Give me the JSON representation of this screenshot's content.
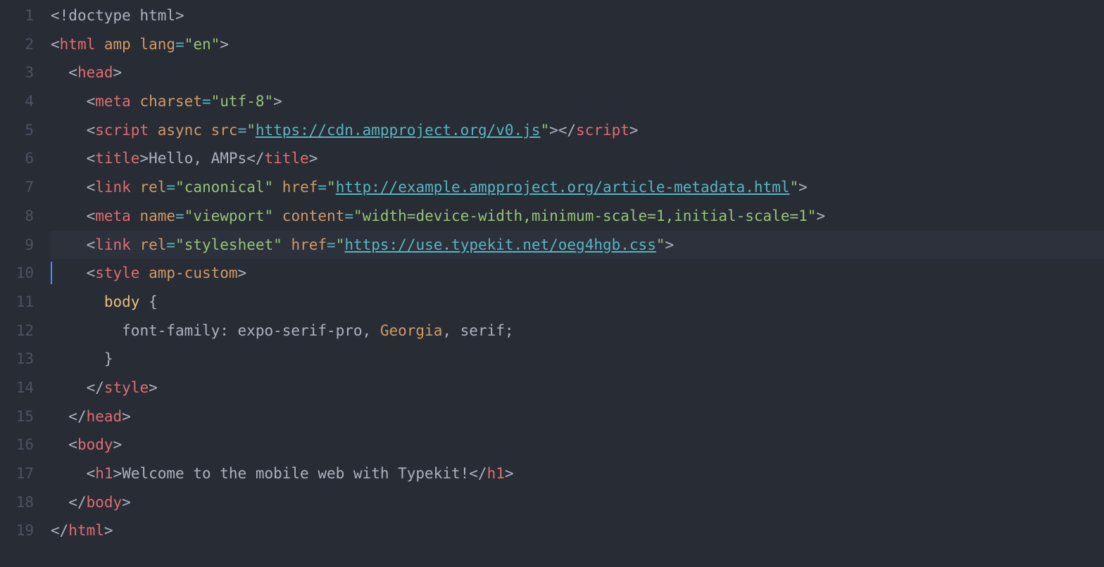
{
  "lines": [
    {
      "num": "1",
      "indent": 0,
      "tokens": [
        {
          "t": "<!",
          "c": "p"
        },
        {
          "t": "doctype html",
          "c": "doctype"
        },
        {
          "t": ">",
          "c": "p"
        }
      ]
    },
    {
      "num": "2",
      "indent": 0,
      "tokens": [
        {
          "t": "<",
          "c": "p"
        },
        {
          "t": "html",
          "c": "tag"
        },
        {
          "t": " ",
          "c": "p"
        },
        {
          "t": "amp",
          "c": "attr"
        },
        {
          "t": " ",
          "c": "p"
        },
        {
          "t": "lang",
          "c": "attr"
        },
        {
          "t": "=",
          "c": "op"
        },
        {
          "t": "\"en\"",
          "c": "str"
        },
        {
          "t": ">",
          "c": "p"
        }
      ]
    },
    {
      "num": "3",
      "indent": 1,
      "tokens": [
        {
          "t": "<",
          "c": "p"
        },
        {
          "t": "head",
          "c": "tag"
        },
        {
          "t": ">",
          "c": "p"
        }
      ]
    },
    {
      "num": "4",
      "indent": 2,
      "tokens": [
        {
          "t": "<",
          "c": "p"
        },
        {
          "t": "meta",
          "c": "tag"
        },
        {
          "t": " ",
          "c": "p"
        },
        {
          "t": "charset",
          "c": "attr"
        },
        {
          "t": "=",
          "c": "op"
        },
        {
          "t": "\"utf-8\"",
          "c": "str"
        },
        {
          "t": ">",
          "c": "p"
        }
      ]
    },
    {
      "num": "5",
      "indent": 2,
      "tokens": [
        {
          "t": "<",
          "c": "p"
        },
        {
          "t": "script",
          "c": "tag"
        },
        {
          "t": " ",
          "c": "p"
        },
        {
          "t": "async",
          "c": "attr"
        },
        {
          "t": " ",
          "c": "p"
        },
        {
          "t": "src",
          "c": "attr"
        },
        {
          "t": "=",
          "c": "op"
        },
        {
          "t": "\"",
          "c": "str"
        },
        {
          "t": "https://cdn.ampproject.org/v0.js",
          "c": "url"
        },
        {
          "t": "\"",
          "c": "str"
        },
        {
          "t": "></",
          "c": "p"
        },
        {
          "t": "script",
          "c": "tag"
        },
        {
          "t": ">",
          "c": "p"
        }
      ]
    },
    {
      "num": "6",
      "indent": 2,
      "tokens": [
        {
          "t": "<",
          "c": "p"
        },
        {
          "t": "title",
          "c": "tag"
        },
        {
          "t": ">",
          "c": "p"
        },
        {
          "t": "Hello, AMPs",
          "c": "text"
        },
        {
          "t": "</",
          "c": "p"
        },
        {
          "t": "title",
          "c": "tag"
        },
        {
          "t": ">",
          "c": "p"
        }
      ]
    },
    {
      "num": "7",
      "indent": 2,
      "tokens": [
        {
          "t": "<",
          "c": "p"
        },
        {
          "t": "link",
          "c": "tag"
        },
        {
          "t": " ",
          "c": "p"
        },
        {
          "t": "rel",
          "c": "attr"
        },
        {
          "t": "=",
          "c": "op"
        },
        {
          "t": "\"canonical\"",
          "c": "str"
        },
        {
          "t": " ",
          "c": "p"
        },
        {
          "t": "href",
          "c": "attr"
        },
        {
          "t": "=",
          "c": "op"
        },
        {
          "t": "\"",
          "c": "str"
        },
        {
          "t": "http://example.ampproject.org/article-metadata.html",
          "c": "url"
        },
        {
          "t": "\"",
          "c": "str"
        },
        {
          "t": ">",
          "c": "p"
        }
      ]
    },
    {
      "num": "8",
      "indent": 2,
      "tokens": [
        {
          "t": "<",
          "c": "p"
        },
        {
          "t": "meta",
          "c": "tag"
        },
        {
          "t": " ",
          "c": "p"
        },
        {
          "t": "name",
          "c": "attr"
        },
        {
          "t": "=",
          "c": "op"
        },
        {
          "t": "\"viewport\"",
          "c": "str"
        },
        {
          "t": " ",
          "c": "p"
        },
        {
          "t": "content",
          "c": "attr"
        },
        {
          "t": "=",
          "c": "op"
        },
        {
          "t": "\"width=device-width,minimum-scale=1,initial-scale=1\"",
          "c": "str"
        },
        {
          "t": ">",
          "c": "p"
        }
      ]
    },
    {
      "num": "9",
      "indent": 2,
      "highlight": true,
      "tokens": [
        {
          "t": "<",
          "c": "p"
        },
        {
          "t": "link",
          "c": "tag"
        },
        {
          "t": " ",
          "c": "p"
        },
        {
          "t": "rel",
          "c": "attr"
        },
        {
          "t": "=",
          "c": "op"
        },
        {
          "t": "\"stylesheet\"",
          "c": "str"
        },
        {
          "t": " ",
          "c": "p"
        },
        {
          "t": "href",
          "c": "attr"
        },
        {
          "t": "=",
          "c": "op"
        },
        {
          "t": "\"",
          "c": "str"
        },
        {
          "t": "https://use.typekit.net/oeg4hgb.css",
          "c": "url"
        },
        {
          "t": "\"",
          "c": "str"
        },
        {
          "t": ">",
          "c": "p"
        }
      ]
    },
    {
      "num": "10",
      "indent": 2,
      "cursor": true,
      "tokens": [
        {
          "t": "<",
          "c": "p"
        },
        {
          "t": "style",
          "c": "tag"
        },
        {
          "t": " ",
          "c": "p"
        },
        {
          "t": "amp-custom",
          "c": "attr"
        },
        {
          "t": ">",
          "c": "p"
        }
      ]
    },
    {
      "num": "11",
      "indent": 3,
      "tokens": [
        {
          "t": "body",
          "c": "css-sel"
        },
        {
          "t": " {",
          "c": "p"
        }
      ]
    },
    {
      "num": "12",
      "indent": 4,
      "tokens": [
        {
          "t": "font-family",
          "c": "css-prop"
        },
        {
          "t": ": ",
          "c": "p"
        },
        {
          "t": "expo-serif-pro",
          "c": "css-val"
        },
        {
          "t": ", ",
          "c": "p"
        },
        {
          "t": "Georgia",
          "c": "css-val-special"
        },
        {
          "t": ", ",
          "c": "p"
        },
        {
          "t": "serif",
          "c": "css-val"
        },
        {
          "t": ";",
          "c": "p"
        }
      ]
    },
    {
      "num": "13",
      "indent": 3,
      "tokens": [
        {
          "t": "}",
          "c": "p"
        }
      ]
    },
    {
      "num": "14",
      "indent": 2,
      "tokens": [
        {
          "t": "</",
          "c": "p"
        },
        {
          "t": "style",
          "c": "tag"
        },
        {
          "t": ">",
          "c": "p"
        }
      ]
    },
    {
      "num": "15",
      "indent": 1,
      "tokens": [
        {
          "t": "</",
          "c": "p"
        },
        {
          "t": "head",
          "c": "tag"
        },
        {
          "t": ">",
          "c": "p"
        }
      ]
    },
    {
      "num": "16",
      "indent": 1,
      "tokens": [
        {
          "t": "<",
          "c": "p"
        },
        {
          "t": "body",
          "c": "tag"
        },
        {
          "t": ">",
          "c": "p"
        }
      ]
    },
    {
      "num": "17",
      "indent": 2,
      "tokens": [
        {
          "t": "<",
          "c": "p"
        },
        {
          "t": "h1",
          "c": "tag"
        },
        {
          "t": ">",
          "c": "p"
        },
        {
          "t": "Welcome to the mobile web with Typekit!",
          "c": "text"
        },
        {
          "t": "</",
          "c": "p"
        },
        {
          "t": "h1",
          "c": "tag"
        },
        {
          "t": ">",
          "c": "p"
        }
      ]
    },
    {
      "num": "18",
      "indent": 1,
      "tokens": [
        {
          "t": "</",
          "c": "p"
        },
        {
          "t": "body",
          "c": "tag"
        },
        {
          "t": ">",
          "c": "p"
        }
      ]
    },
    {
      "num": "19",
      "indent": 0,
      "tokens": [
        {
          "t": "</",
          "c": "p"
        },
        {
          "t": "html",
          "c": "tag"
        },
        {
          "t": ">",
          "c": "p"
        }
      ]
    }
  ],
  "indentUnit": "  "
}
